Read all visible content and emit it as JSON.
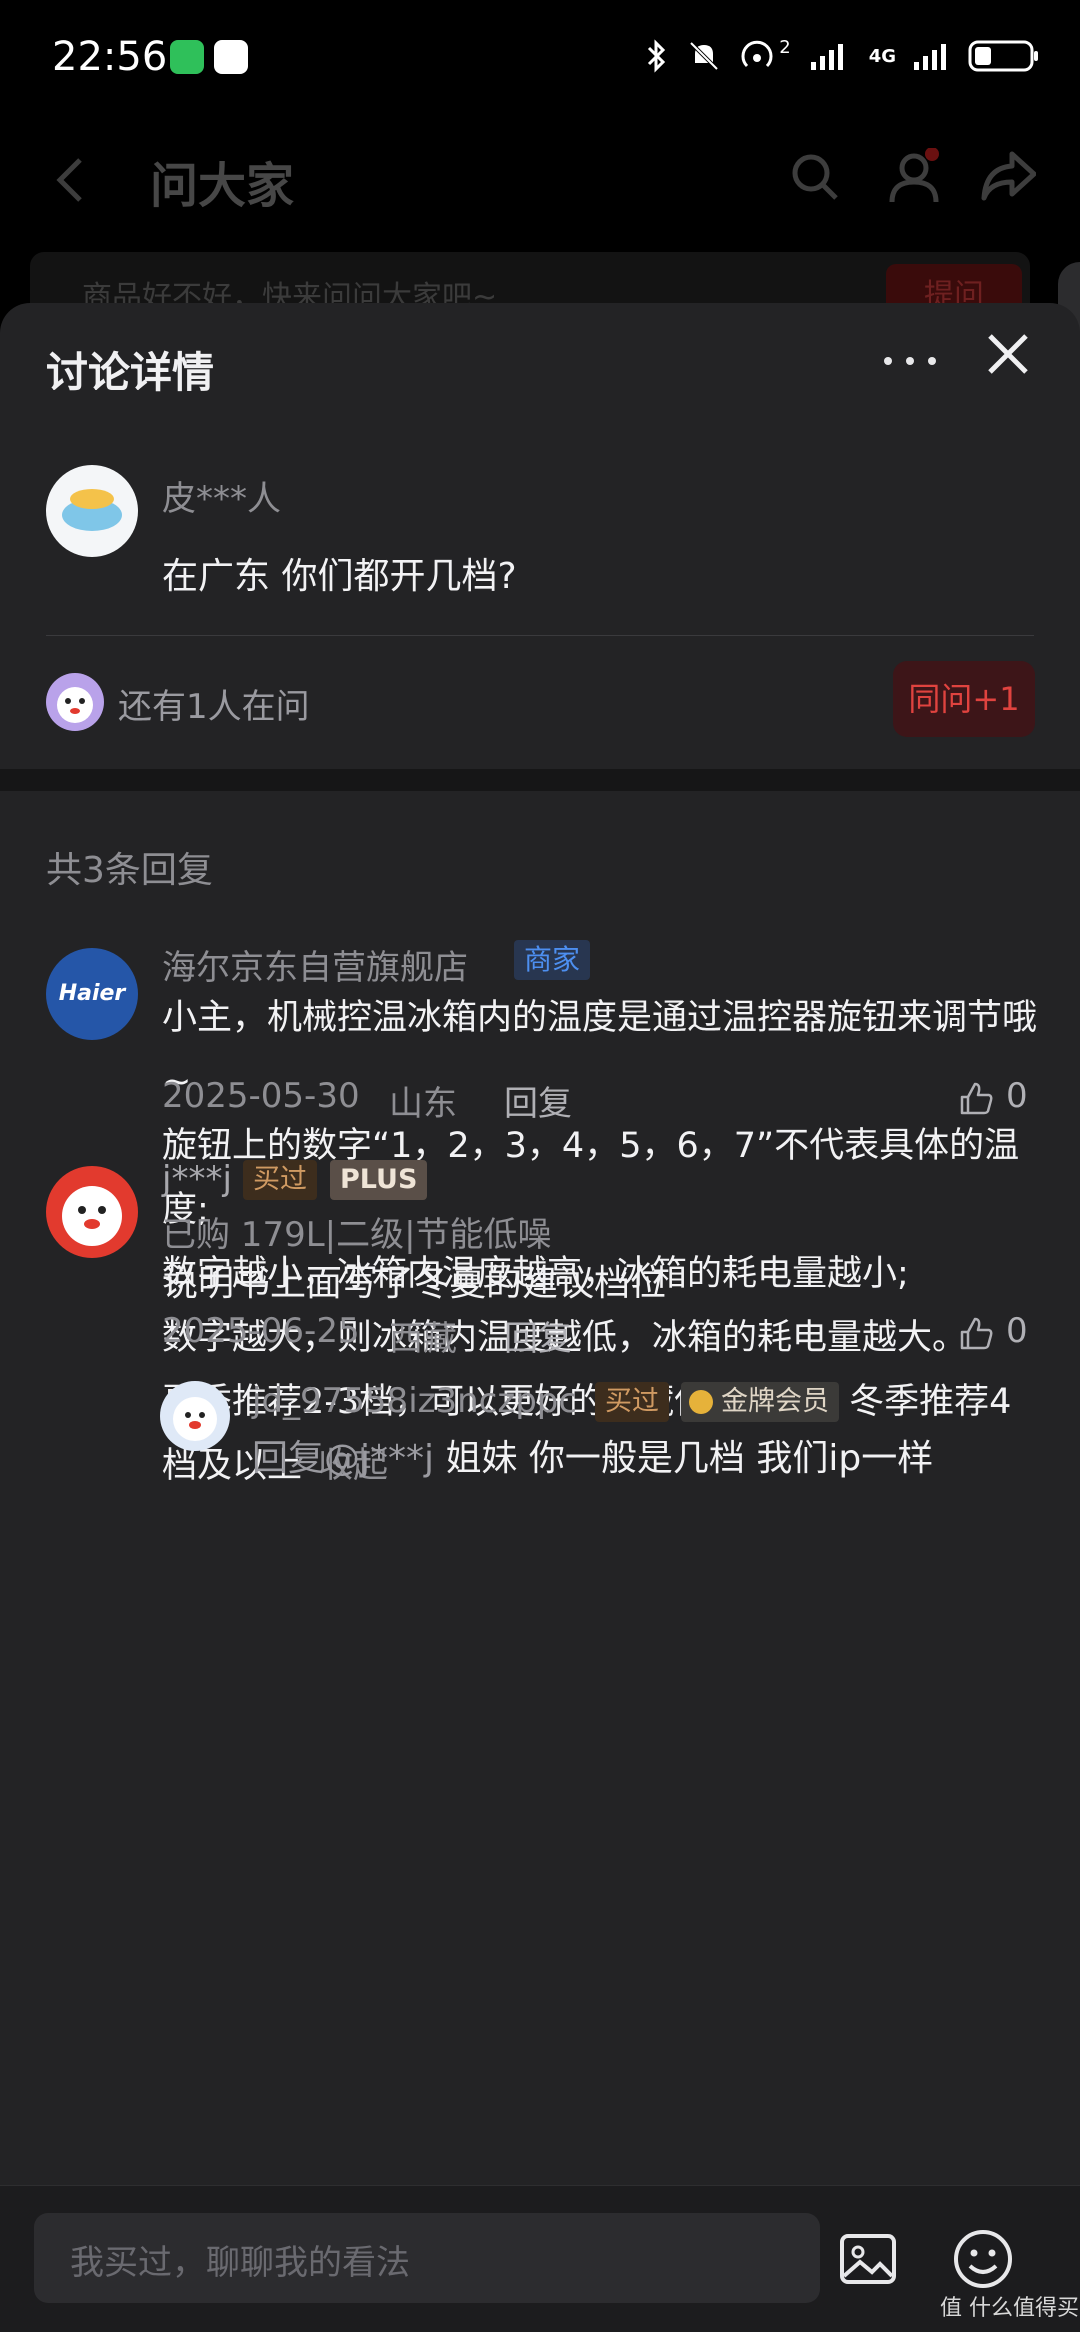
{
  "status_bar": {
    "time": "22:56",
    "signal_label": "4G",
    "wifi_superscript": "2"
  },
  "background_page": {
    "title": "问大家",
    "search_placeholder": "商品好不好，快来问问大家吧~",
    "ask_button": "提问"
  },
  "sheet": {
    "title": "讨论详情",
    "question": {
      "user": "皮***人",
      "text": "在广东 你们都开几档?",
      "others_asking": "还有1人在问",
      "same_question_button": "同问+1"
    },
    "reply_count": "共3条回复",
    "replies": [
      {
        "avatar_text": "Haier",
        "user": "海尔京东自营旗舰店",
        "badge": "商家",
        "lines": [
          "小主，机械控温冰箱内的温度是通过温控器旋钮来调节哦~",
          "旋钮上的数字“1，2，3，4，5，6，7”不代表具体的温度;",
          "数字越小，冰箱内温度越高，冰箱的耗电量越小;",
          "数字越大，则冰箱内温度越低，冰箱的耗电量越大。",
          "夏季推荐2-3档，可以更好的冷藏保鲜食物；冬季推荐4档及以上"
        ],
        "collapse_label": "收起",
        "date": "2025-05-30",
        "location": "山东",
        "reply_label": "回复",
        "likes": "0"
      },
      {
        "user": "j***j",
        "badge_bought": "买过",
        "badge_plus": "PLUS",
        "sku": "已购 179L|二级|节能低噪",
        "text": "说明书上面写了冬夏的建议档位",
        "date": "2025-06-25",
        "location": "西藏",
        "reply_label": "回复",
        "likes": "0"
      },
      {
        "user": "jd_97558iz3nczppc",
        "badge_bought": "买过",
        "badge_gold": "金牌会员",
        "reply_to": "回复@j***j",
        "text": "姐妹 你一般是几档 我们ip一样"
      }
    ]
  },
  "bottom_bar": {
    "placeholder": "我买过，聊聊我的看法"
  },
  "watermark": "值 什么值得买",
  "colors": {
    "sheet_bg": "#232325",
    "accent_red": "#e0433f",
    "merchant_blue": "#4d8ff0",
    "haier_blue": "#2556a8"
  }
}
